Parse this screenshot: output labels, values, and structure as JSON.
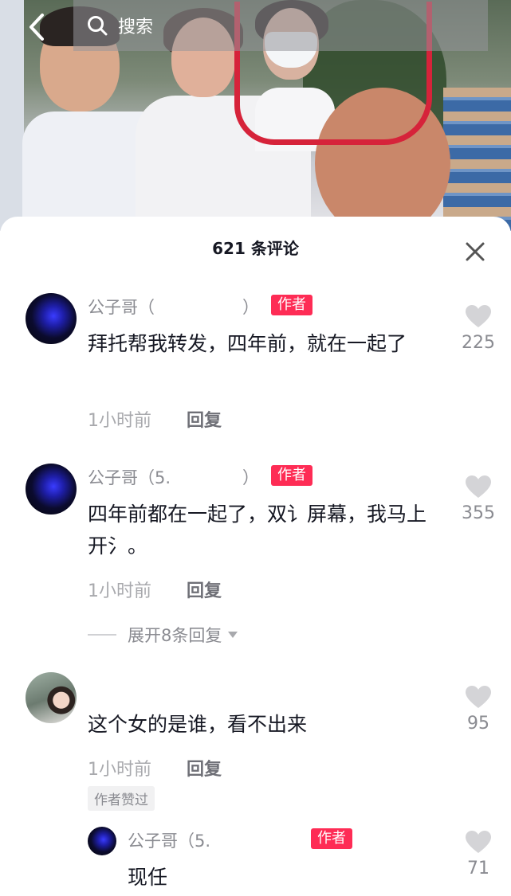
{
  "header": {
    "search_placeholder": "搜索"
  },
  "sheet": {
    "title": "621 条评论"
  },
  "comments": [
    {
      "name": "公子哥（",
      "name_tail": "）",
      "badge": "作者",
      "text": "拜托帮我转发，四年前，就在一起了",
      "time": "1小时前",
      "reply_label": "回复",
      "likes": "225"
    },
    {
      "name": "公子哥（5.",
      "name_tail": "）",
      "badge": "作者",
      "text": "四年前都在一起了，双讠屏幕，我马上开氵。",
      "time": "1小时前",
      "reply_label": "回复",
      "likes": "355",
      "expand_label": "展开8条回复"
    },
    {
      "name": "",
      "text": "这个女的是谁，看不出来",
      "time": "1小时前",
      "reply_label": "回复",
      "likes": "95",
      "liked_by_author": "作者赞过"
    }
  ],
  "reply": {
    "name": "公子哥（5.",
    "badge": "作者",
    "text": "现任",
    "likes": "71"
  },
  "colors": {
    "accent": "#fe2c55",
    "text_primary": "#161823",
    "text_secondary": "#8a8b91",
    "highlight": "#d6233a"
  }
}
